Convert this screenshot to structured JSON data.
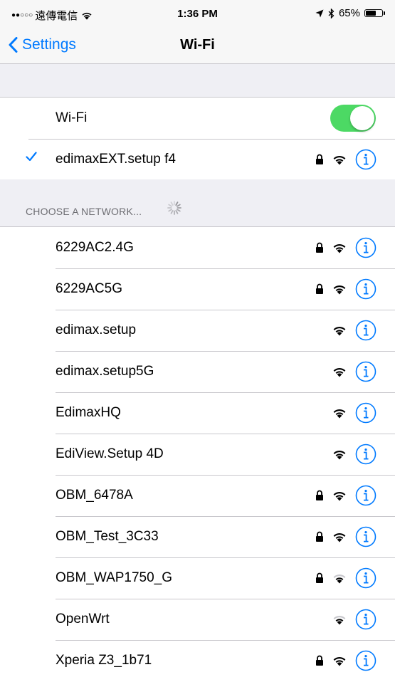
{
  "status_bar": {
    "signal": "●●○○○",
    "carrier": "遠傳電信",
    "time": "1:36 PM",
    "battery": "65%",
    "battery_level": 0.65,
    "icons": [
      "wifi-icon",
      "location-arrow-icon",
      "bluetooth-icon",
      "battery-icon"
    ]
  },
  "nav": {
    "back_label": "Settings",
    "title": "Wi-Fi"
  },
  "wifi_toggle": {
    "label": "Wi-Fi",
    "on": true,
    "accent": "#4cd964"
  },
  "connected": {
    "name": "edimaxEXT.setup f4",
    "secured": true
  },
  "section": {
    "header": "CHOOSE A NETWORK..."
  },
  "networks": [
    {
      "name": "6229AC2.4G",
      "secured": true,
      "signal": "full"
    },
    {
      "name": "6229AC5G",
      "secured": true,
      "signal": "full"
    },
    {
      "name": "edimax.setup",
      "secured": false,
      "signal": "full"
    },
    {
      "name": "edimax.setup5G",
      "secured": false,
      "signal": "full"
    },
    {
      "name": "EdimaxHQ",
      "secured": false,
      "signal": "full"
    },
    {
      "name": "EdiView.Setup 4D",
      "secured": false,
      "signal": "full"
    },
    {
      "name": "OBM_6478A",
      "secured": true,
      "signal": "full"
    },
    {
      "name": "OBM_Test_3C33",
      "secured": true,
      "signal": "full"
    },
    {
      "name": "OBM_WAP1750_G",
      "secured": true,
      "signal": "weak"
    },
    {
      "name": "OpenWrt",
      "secured": false,
      "signal": "weak"
    },
    {
      "name": "Xperia Z3_1b71",
      "secured": true,
      "signal": "full"
    }
  ],
  "colors": {
    "accent": "#007aff",
    "toggle_on": "#4cd964",
    "group_bg": "#efeff4",
    "separator": "#c8c7cc"
  }
}
